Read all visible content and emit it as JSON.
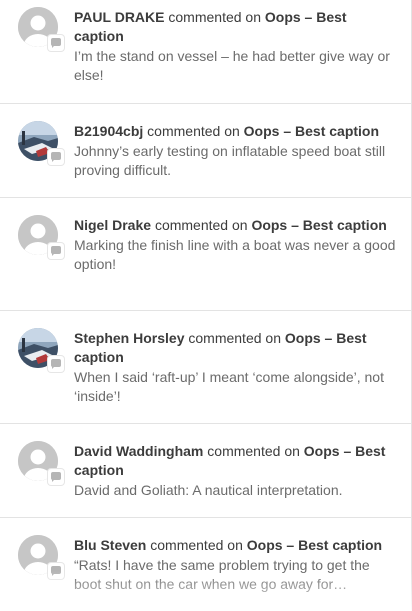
{
  "activity": {
    "verb": "commented on",
    "items": [
      {
        "author": "PAUL DRAKE",
        "post": "Oops – Best caption",
        "excerpt": "I’m the stand on vessel – he had better give way or else!",
        "avatar": "default-avatar-icon"
      },
      {
        "author": "B21904cbj",
        "post": "Oops – Best caption",
        "excerpt": "Johnny’s early testing on inflatable speed boat still proving difficult.",
        "avatar": "photo-avatar"
      },
      {
        "author": "Nigel Drake",
        "post": "Oops – Best caption",
        "excerpt": "Marking the finish line with a boat was never a good option!",
        "avatar": "default-avatar-icon"
      },
      {
        "author": "Stephen Horsley",
        "post": "Oops – Best caption",
        "excerpt": "When I said ‘raft-up’ I meant ‘come alongside’, not ‘inside’!",
        "avatar": "photo-avatar"
      },
      {
        "author": "David Waddingham",
        "post": "Oops – Best caption",
        "excerpt": "David and Goliath: A nautical interpretation.",
        "avatar": "default-avatar-icon"
      },
      {
        "author": "Blu Steven",
        "post": "Oops – Best caption",
        "excerpt": "“Rats! I have the same problem trying to get the boot shut on the car when we go away for…",
        "avatar": "default-avatar-icon"
      }
    ]
  }
}
